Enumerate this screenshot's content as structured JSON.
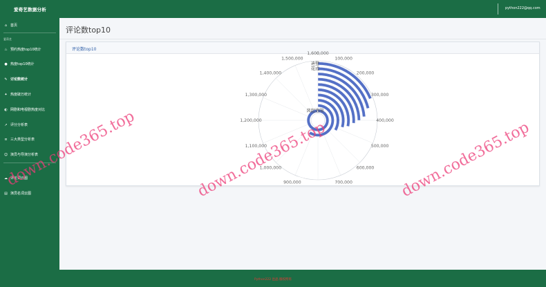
{
  "header": {
    "brand": "爱奇艺数据分析",
    "user_email": "python222@qq.com"
  },
  "sidebar": {
    "items": [
      {
        "label": "首页",
        "icon": "home-icon",
        "glyph": "⌂"
      },
      {
        "label": "预约热度top10统计",
        "icon": "fire-icon",
        "glyph": "♨"
      },
      {
        "label": "热度top10统计",
        "icon": "apple-icon",
        "glyph": "●"
      },
      {
        "label": "讨论数统计",
        "icon": "comment-icon",
        "glyph": "✎"
      },
      {
        "label": "热度破万统计",
        "icon": "bolt-icon",
        "glyph": "✦"
      },
      {
        "label": "网剧和电视剧热度对比",
        "icon": "contrast-icon",
        "glyph": "◐"
      },
      {
        "label": "评分分析表",
        "icon": "chart-icon",
        "glyph": "↗"
      },
      {
        "label": "三大类型分析表",
        "icon": "layers-icon",
        "glyph": "≡"
      },
      {
        "label": "演员与导演分析表",
        "icon": "users-icon",
        "glyph": "☺"
      },
      {
        "label": "评论词云图",
        "icon": "cloud-icon",
        "glyph": "☁"
      },
      {
        "label": "演员名词云图",
        "icon": "clipboard-icon",
        "glyph": "▤"
      }
    ],
    "group_label": "爱奇艺"
  },
  "page": {
    "title": "评论数top10",
    "card_title": "评论数top10"
  },
  "footer": {
    "text": "Python222 出品 版权所有"
  },
  "watermark": {
    "text": "down.code365.top"
  },
  "colors": {
    "brand_green": "#1b6d45",
    "bar_blue": "#5470c6",
    "title_blue": "#2f5fa8",
    "watermark_pink": "#ec3c78"
  },
  "chart_data": {
    "type": "bar",
    "coordinate": "polar",
    "angle_axis": {
      "min": 0,
      "max": 1600000,
      "ticks": [
        0,
        100000,
        200000,
        300000,
        400000,
        500000,
        600000,
        700000,
        800000,
        900000,
        1000000,
        1100000,
        1200000,
        1300000,
        1400000,
        1500000,
        1600000
      ],
      "tick_labels": [
        "0",
        "100,000",
        "200,000",
        "300,000",
        "400,000",
        "500,000",
        "600,000",
        "700,000",
        "800,000",
        "900,000",
        "1,000,000",
        "1,100,000",
        "1,200,000",
        "1,300,000",
        "1,400,000",
        "1,500,000",
        "1,600,000"
      ]
    },
    "categories": [
      "风起洛阳",
      "",
      "",
      "",
      "",
      "",
      "",
      "",
      "花戎",
      "迪登"
    ],
    "series": [
      {
        "values": [
          1580000,
          950000,
          530000,
          470000,
          450000,
          420000,
          400000,
          380000,
          340000,
          300000
        ]
      }
    ],
    "data_labels": [
      "迪登: 1580000",
      "",
      "",
      "",
      "",
      "",
      "",
      "",
      "",
      ""
    ],
    "grid": false,
    "legend": "none"
  }
}
